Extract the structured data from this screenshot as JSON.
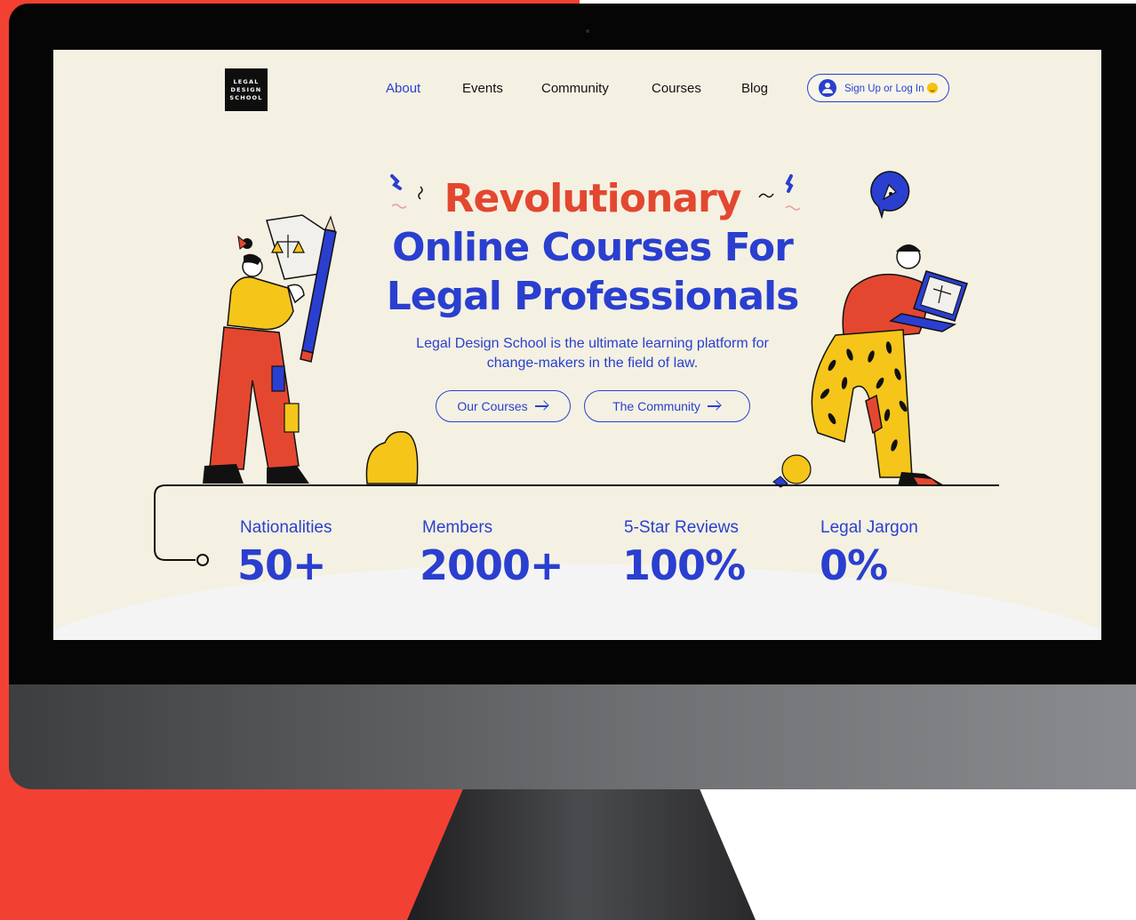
{
  "logo": {
    "line1": "LEGAL",
    "line2": "DESIGN",
    "line3": "SCHOOL"
  },
  "nav": {
    "items": [
      {
        "label": "About",
        "active": true
      },
      {
        "label": "Events"
      },
      {
        "label": "Community"
      },
      {
        "label": "Courses"
      },
      {
        "label": "Blog"
      }
    ],
    "signup_label": "Sign Up or Log In"
  },
  "hero": {
    "title_highlight": "Revolutionary",
    "title_line2": "Online Courses For",
    "title_line3": "Legal Professionals",
    "subtitle_line1": "Legal Design School is the ultimate learning platform for",
    "subtitle_line2": "change-makers in the field of law.",
    "cta_primary": "Our Courses",
    "cta_secondary": "The Community"
  },
  "stats": [
    {
      "label": "Nationalities",
      "value": "50+"
    },
    {
      "label": "Members",
      "value": "2000+"
    },
    {
      "label": "5-Star Reviews",
      "value": "100%"
    },
    {
      "label": "Legal Jargon",
      "value": "0%"
    }
  ],
  "colors": {
    "brand_blue": "#2a3fcf",
    "accent_red": "#e4472f",
    "background_cream": "#f4f1e3",
    "backdrop_red": "#f24133"
  },
  "icons": [
    "user-avatar-icon",
    "smile-emoji-icon",
    "arrow-right-icon",
    "pen-nib-badge-icon"
  ]
}
